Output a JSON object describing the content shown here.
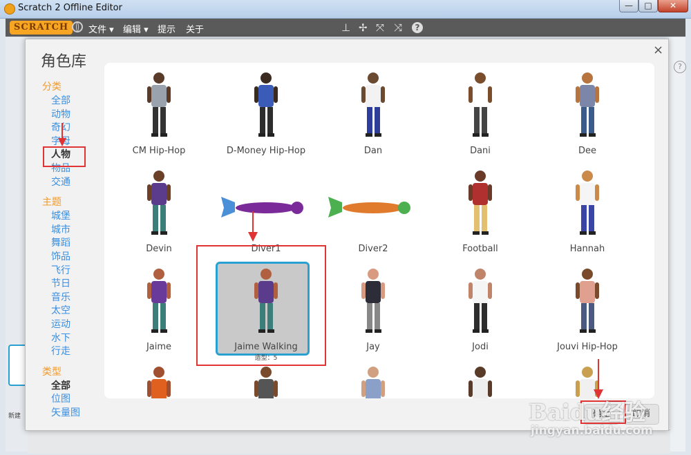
{
  "window": {
    "title": "Scratch 2 Offline Editor",
    "minimize": "—",
    "maximize": "□",
    "close": "✕"
  },
  "menubar": {
    "logo": "SCRATCH",
    "items": [
      "文件 ▾",
      "编辑 ▾",
      "提示",
      "关于"
    ],
    "tool_icons": [
      "stamp-icon",
      "cut-icon",
      "grow-icon",
      "shrink-icon",
      "help-icon"
    ]
  },
  "dialog": {
    "title": "角色库",
    "close": "×",
    "sections": [
      {
        "heading": "分类",
        "items": [
          "全部",
          "动物",
          "奇幻",
          "字母",
          "人物",
          "物品",
          "交通"
        ],
        "selected": "人物"
      },
      {
        "heading": "主题",
        "items": [
          "城堡",
          "城市",
          "舞蹈",
          "饰品",
          "飞行",
          "节日",
          "音乐",
          "太空",
          "运动",
          "水下",
          "行走"
        ]
      },
      {
        "heading": "类型",
        "items": [
          "全部",
          "位图",
          "矢量图"
        ],
        "selected": "全部"
      }
    ],
    "sprites": [
      {
        "name": "CM Hip-Hop"
      },
      {
        "name": "D-Money Hip-Hop"
      },
      {
        "name": "Dan"
      },
      {
        "name": "Dani"
      },
      {
        "name": "Dee"
      },
      {
        "name": "Devin"
      },
      {
        "name": "Diver1"
      },
      {
        "name": "Diver2"
      },
      {
        "name": "Football"
      },
      {
        "name": "Hannah"
      },
      {
        "name": "Jaime"
      },
      {
        "name": "Jaime Walking",
        "costumes": "造型：5",
        "selected": true
      },
      {
        "name": "Jay"
      },
      {
        "name": "Jodi"
      },
      {
        "name": "Jouvi Hip-Hop"
      },
      {
        "name": ""
      },
      {
        "name": ""
      },
      {
        "name": ""
      },
      {
        "name": ""
      },
      {
        "name": ""
      }
    ],
    "ok_button": "确定",
    "cancel_button": "取消"
  },
  "side": {
    "new_sprite_label": "新建",
    "help": "?"
  },
  "watermark": {
    "brand": "Baidu经验",
    "url": "jingyan.baidu.com"
  },
  "colors": {
    "accent": "#29a0d2",
    "category_heading": "#f19a2b",
    "category_link": "#3a8fe0",
    "annotation": "#e03434"
  }
}
